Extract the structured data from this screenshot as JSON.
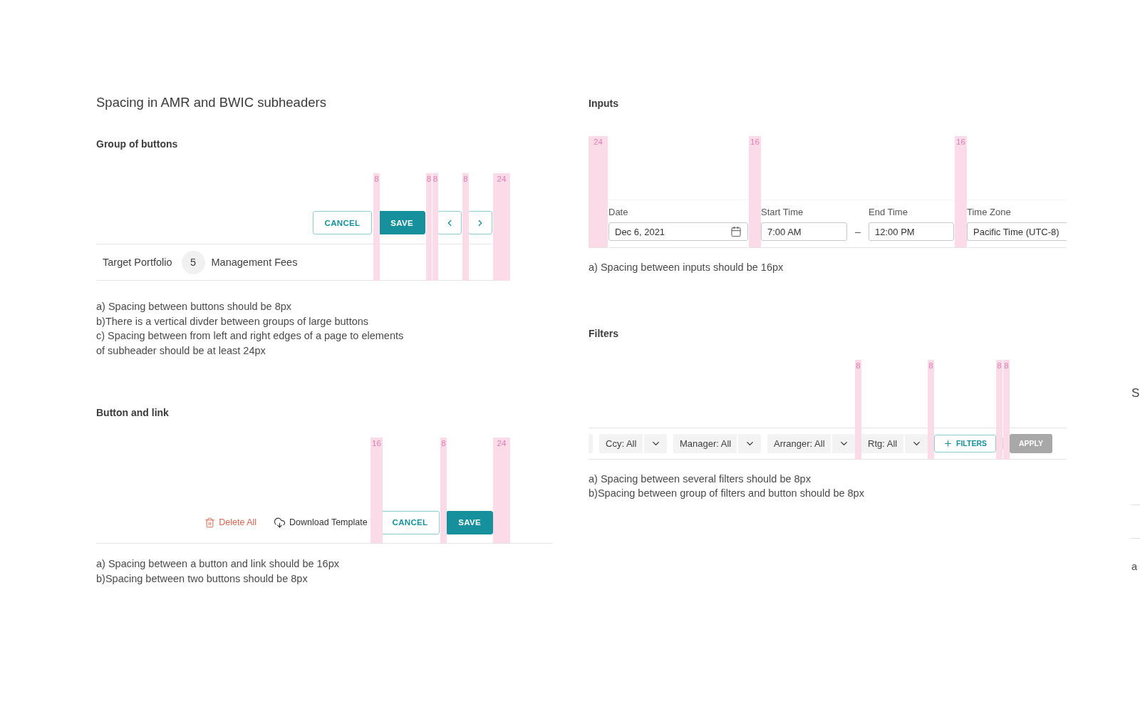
{
  "subheader_spacing": {
    "title": "Spacing in AMR and BWIC subheaders",
    "group_of_buttons": {
      "heading": "Group of buttons",
      "spacing_markers": [
        {
          "label": "8"
        },
        {
          "label": "8"
        },
        {
          "label": "8"
        },
        {
          "label": "8"
        },
        {
          "label": "24"
        }
      ],
      "buttons": [
        {
          "label": "CANCEL",
          "kind": "outline"
        },
        {
          "label": "SAVE",
          "kind": "primary"
        }
      ],
      "subheader": {
        "title": "Target Portfolio",
        "count": "5",
        "subtitle": "Management Fees"
      },
      "notes": [
        "a) Spacing between buttons should be 8px",
        "b)There is a vertical divder between groups of large buttons",
        "c) Spacing between from left and right edges of a page to elements of subheader should be at least 24px"
      ]
    },
    "button_and_link": {
      "heading": "Button and link",
      "spacing_markers": [
        {
          "label": "16"
        },
        {
          "label": "8"
        },
        {
          "label": "24"
        }
      ],
      "links": [
        {
          "label": "Delete All",
          "kind": "danger"
        },
        {
          "label": "Download Template",
          "kind": "download"
        }
      ],
      "buttons": [
        {
          "label": "CANCEL",
          "kind": "outline"
        },
        {
          "label": "SAVE",
          "kind": "primary"
        }
      ],
      "notes": [
        "a) Spacing between a button and link should be 16px",
        "b)Spacing between two buttons should be 8px"
      ]
    }
  },
  "inputs": {
    "heading": "Inputs",
    "spacing_markers": [
      {
        "label": "24"
      },
      {
        "label": "16"
      },
      {
        "label": "16"
      }
    ],
    "fields": [
      {
        "label": "Date",
        "value": "Dec 6, 2021",
        "kind": "date"
      },
      {
        "label": "Start Time",
        "value": "7:00 AM",
        "kind": "text"
      },
      {
        "label": "End Time",
        "value": "12:00 PM",
        "kind": "text"
      },
      {
        "label": "Time Zone",
        "value": "Pacific Time (UTC-8)",
        "kind": "text"
      }
    ],
    "range_separator": "–",
    "notes": [
      "a) Spacing between inputs should be 16px"
    ]
  },
  "filters": {
    "heading": "Filters",
    "spacing_markers": [
      {
        "label": "8"
      },
      {
        "label": "8"
      },
      {
        "label": "8"
      },
      {
        "label": "8"
      }
    ],
    "filters": [
      {
        "label": "Ccy: All"
      },
      {
        "label": "Manager: All"
      },
      {
        "label": "Arranger: All"
      },
      {
        "label": "Rtg: All"
      }
    ],
    "add_filters_button": {
      "label": "FILTERS"
    },
    "apply_button": {
      "label": "APPLY",
      "disabled": true
    },
    "notes": [
      "a) Spacing between several filters should be 8px",
      "b)Spacing between group of filters and button should be 8px"
    ]
  },
  "next_section": {
    "title_fragment": "S",
    "note_fragment": "a"
  }
}
